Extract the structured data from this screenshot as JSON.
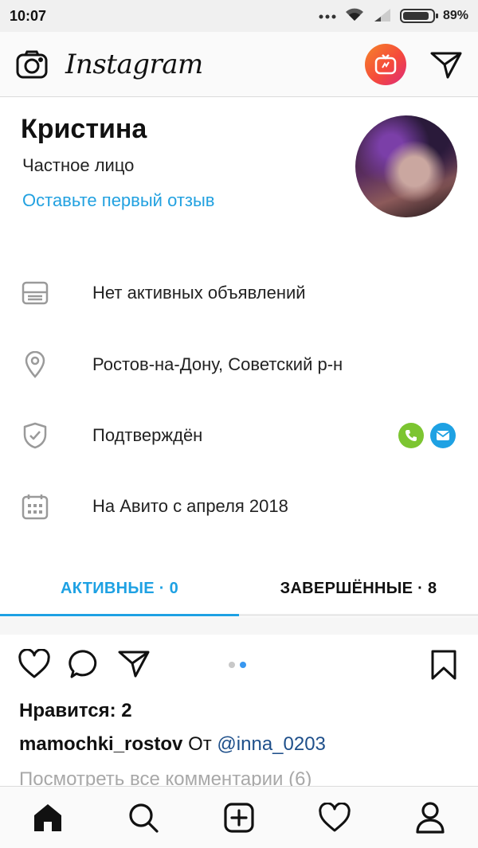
{
  "status_bar": {
    "time": "10:07",
    "battery_text": "89%",
    "battery_level": 0.89,
    "icons": [
      "more-dots-icon",
      "wifi-icon",
      "signal-icon",
      "battery-icon"
    ]
  },
  "header": {
    "app_name": "Instagram",
    "icons": [
      "camera-icon",
      "igtv-icon",
      "direct-send-icon"
    ],
    "igtv_gradient": [
      "#f58529",
      "#dd2a7b"
    ]
  },
  "profile": {
    "name": "Кристина",
    "type": "Частное лицо",
    "review_link": "Оставьте первый отзыв",
    "avatar": "avatar-photo"
  },
  "info_rows": [
    {
      "icon": "listing-icon",
      "text": "Нет активных объявлений"
    },
    {
      "icon": "location-pin-icon",
      "text": "Ростов-на-Дону, Советский р-н"
    },
    {
      "icon": "shield-check-icon",
      "text": "Подтверждён"
    },
    {
      "icon": "calendar-icon",
      "text": "На Авито с апреля 2018"
    }
  ],
  "verification_badges": {
    "phone": {
      "icon": "phone-icon",
      "color": "#7cc531"
    },
    "email": {
      "icon": "mail-icon",
      "color": "#1ea1e3"
    }
  },
  "tabs": [
    {
      "label": "АКТИВНЫЕ · 0",
      "active": true
    },
    {
      "label": "ЗАВЕРШЁННЫЕ · 8",
      "active": false
    }
  ],
  "post": {
    "actions": [
      "heart-icon",
      "comment-icon",
      "share-icon",
      "bookmark-icon"
    ],
    "carousel_dots": 2,
    "carousel_active": 2,
    "likes": "Нравится: 2",
    "caption_user": "mamochki_rostov",
    "caption_text": "От",
    "caption_mention": "@inna_0203",
    "comments_link": "Посмотреть все комментарии (6)"
  },
  "bottom_nav": [
    "home-icon",
    "search-icon",
    "add-post-icon",
    "activity-heart-icon",
    "profile-icon"
  ],
  "colors": {
    "accent_blue": "#1ea1e3",
    "link_blue": "#22a1e0",
    "mention_blue": "#1e4f8a"
  }
}
